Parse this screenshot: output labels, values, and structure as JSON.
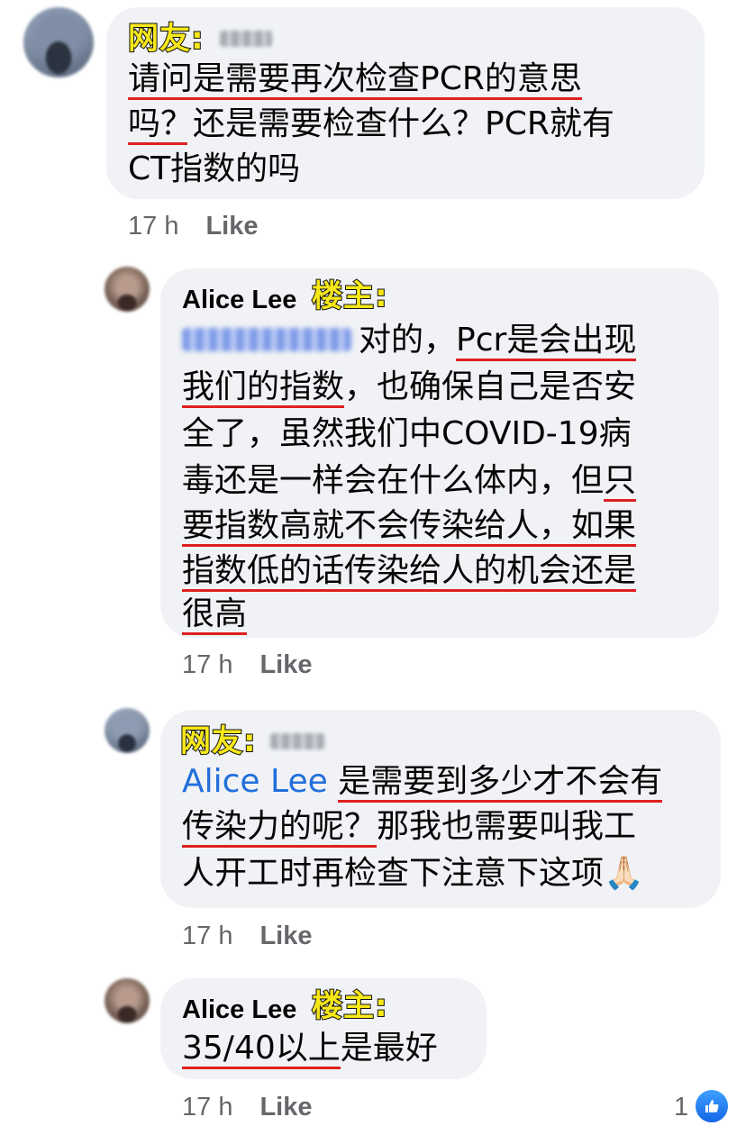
{
  "comments": [
    {
      "tag": "网友:",
      "lines": [
        "请问是需要再次检查PCR的意思",
        "吗？还是需要检查什么？PCR就有",
        "CT指数的吗"
      ],
      "time": "17 h",
      "like": "Like"
    },
    {
      "author": "Alice Lee",
      "tag": "楼主:",
      "line1_rest_a": "对的，",
      "line1_rest_b": "Pcr是会出现",
      "lines": [
        "我们的指数",
        "，也确保自己是否安",
        "全了，虽然我们中COVID-19病",
        "毒还是一样会在什么体内，但",
        "只",
        "要指数高就不会传染给人，如果",
        "指数低的话传染给人的机会还是",
        "很高"
      ],
      "time": "17 h",
      "like": "Like"
    },
    {
      "tag": "网友:",
      "mention": "Alice Lee",
      "lines": [
        "是需要到多少才不会有",
        "传染力的呢？",
        "那我也需要叫我工",
        "人开工时再检查下注意下这项"
      ],
      "emoji": "🙏🏻",
      "time": "17 h",
      "like": "Like"
    },
    {
      "author": "Alice Lee",
      "tag": "楼主:",
      "lines": [
        "35/40以上",
        "是最好"
      ],
      "time": "17 h",
      "like": "Like",
      "reaction_count": "1"
    }
  ],
  "icons": {
    "reaction": "like-thumb-icon",
    "reaction_color": "#1877f2"
  }
}
